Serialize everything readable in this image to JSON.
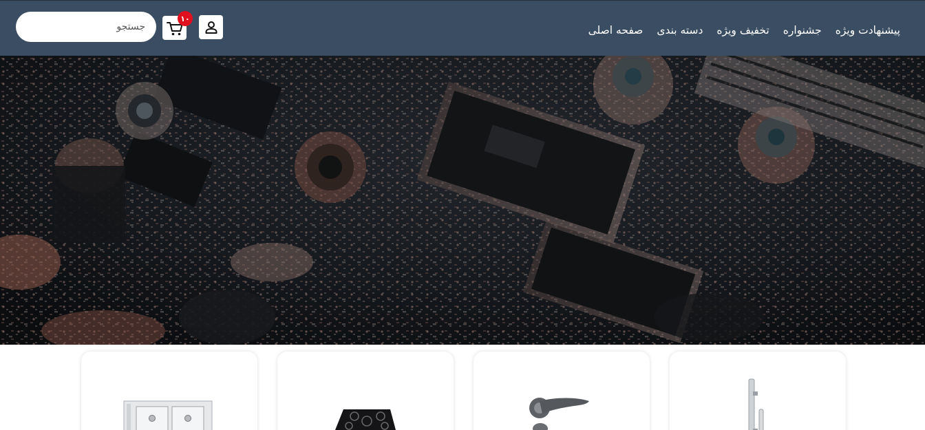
{
  "nav": {
    "items": [
      {
        "label": "صفحه اصلی"
      },
      {
        "label": "دسته بندی"
      },
      {
        "label": "تخفیف ویژه"
      },
      {
        "label": "جشنواره"
      },
      {
        "label": "پیشنهادت ویژه"
      }
    ]
  },
  "search": {
    "placeholder": "جستجو",
    "value": ""
  },
  "cart": {
    "count": "۱۰",
    "icon": "cart-icon"
  },
  "user": {
    "icon": "user-icon"
  },
  "hero": {
    "image": "circuit-board-photo"
  },
  "products": [
    {
      "image": "door-handle-vertical"
    },
    {
      "image": "lever-door-handle"
    },
    {
      "image": "black-gas-cooktop"
    },
    {
      "image": "stainless-double-sink"
    }
  ],
  "colors": {
    "header_bg": "#3b4d63",
    "badge": "#e0101e",
    "text_light": "#ffffff"
  }
}
